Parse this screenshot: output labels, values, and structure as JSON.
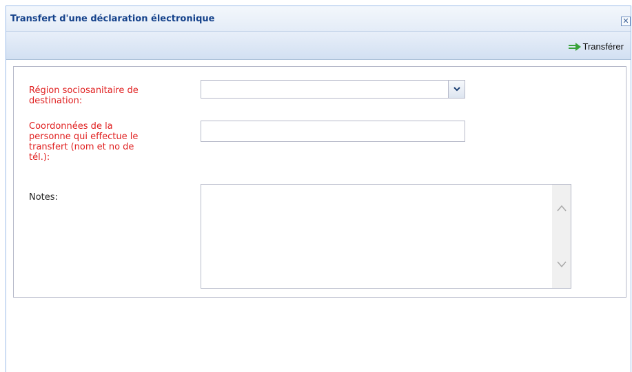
{
  "window": {
    "title": "Transfert d'une déclaration électronique",
    "close_glyph": "✕"
  },
  "toolbar": {
    "transfer_label": "Transférer",
    "transfer_icon": "arrow-right-icon",
    "transfer_icon_color": "#3aa33a"
  },
  "form": {
    "region_label": "Région sociosanitaire de\ndestination:",
    "region_value": "",
    "contact_label": "Coordonnées de la\npersonne qui effectue le\ntransfert (nom et no de\ntél.):",
    "contact_value": "",
    "notes_label": "Notes:",
    "notes_value": ""
  },
  "colors": {
    "required_label": "#e02020",
    "title_text": "#15428b",
    "field_border": "#b5b8c8"
  }
}
